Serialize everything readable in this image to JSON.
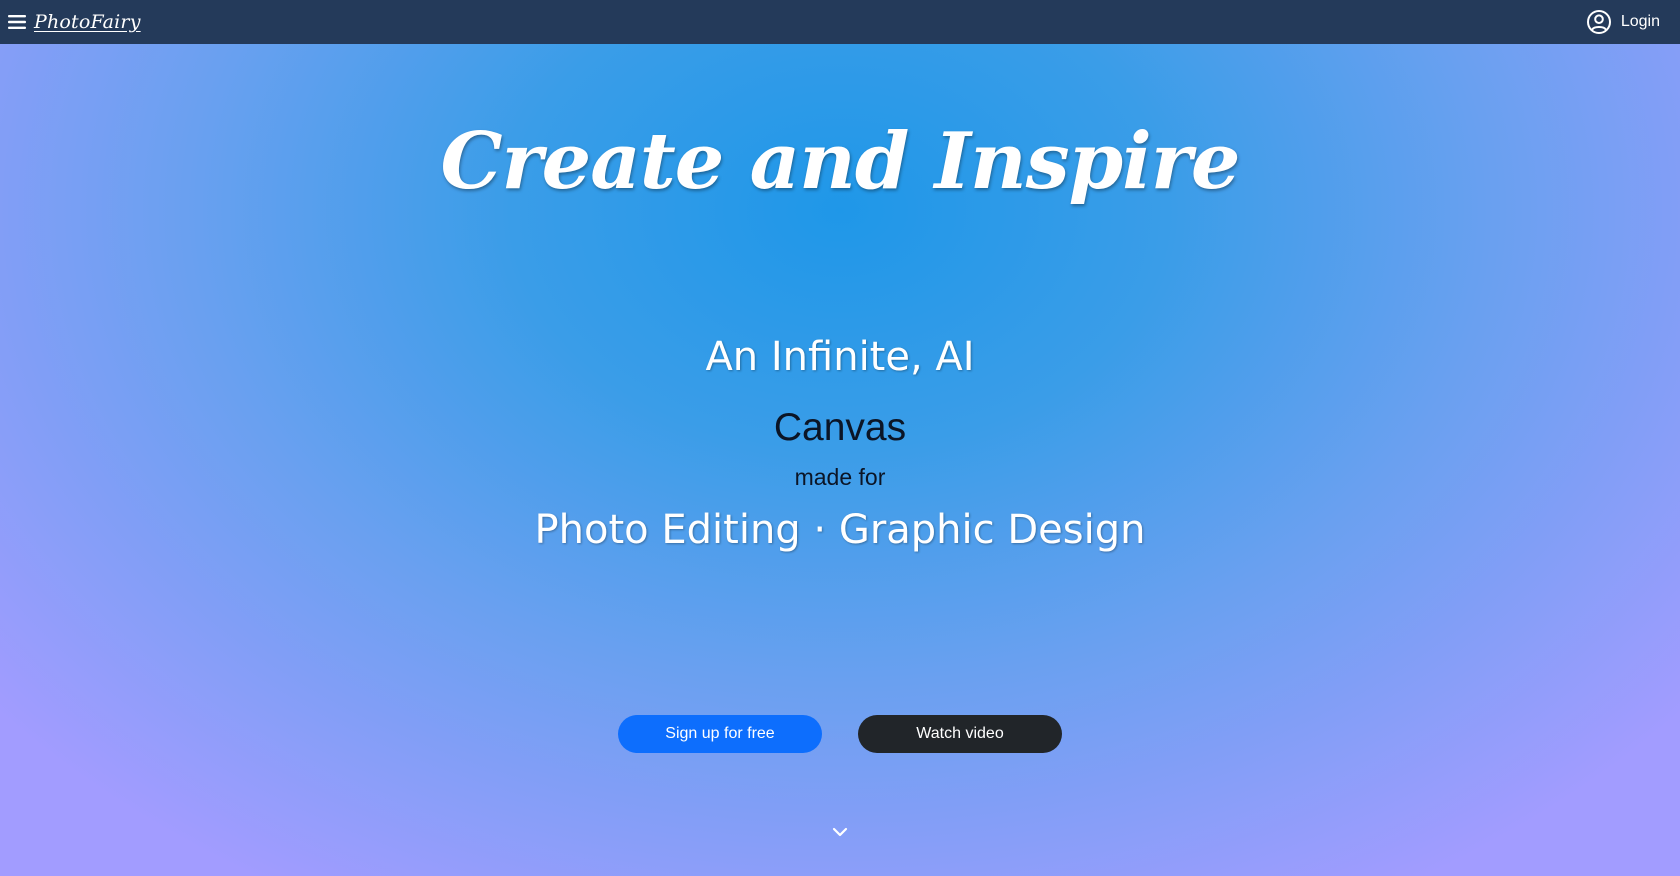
{
  "navbar": {
    "menu_icon": "hamburger-menu-icon",
    "brand": "PhotoFairy",
    "user_icon": "user-circle-icon",
    "login_label": "Login"
  },
  "hero": {
    "headline": "Create and Inspire",
    "line_ai": "An Infinite, AI",
    "line_canvas": "Canvas",
    "line_made_for": "made for",
    "line_uses": "Photo Editing · Graphic Design",
    "signup_label": "Sign up for free",
    "video_label": "Watch video",
    "scroll_icon": "chevron-down-icon"
  },
  "colors": {
    "navbar_bg": "#243a5a",
    "hero_center": "#1f97e8",
    "hero_edge": "#a29cff",
    "signup_button": "#0d6efd",
    "video_button": "#212529",
    "dark_text": "#0b1526"
  }
}
